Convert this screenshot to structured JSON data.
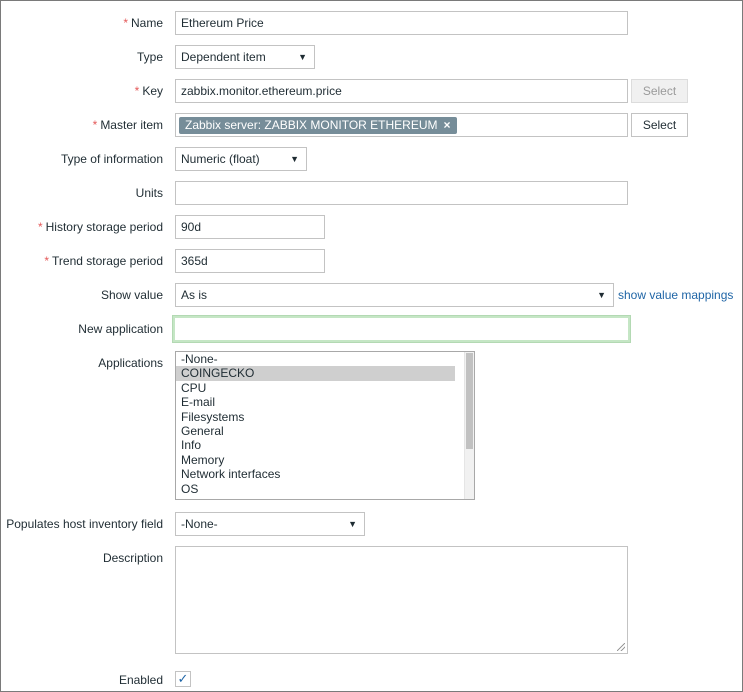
{
  "form": {
    "name": {
      "label": "Name",
      "required": "*",
      "value": "Ethereum Price"
    },
    "type": {
      "label": "Type",
      "value": "Dependent item"
    },
    "key": {
      "label": "Key",
      "required": "*",
      "value": "zabbix.monitor.ethereum.price",
      "button": "Select"
    },
    "master_item": {
      "label": "Master item",
      "required": "*",
      "tag": "Zabbix server: ZABBIX MONITOR ETHEREUM",
      "remove_icon": "×",
      "button": "Select"
    },
    "type_of_information": {
      "label": "Type of information",
      "value": "Numeric (float)"
    },
    "units": {
      "label": "Units",
      "value": ""
    },
    "history": {
      "label": "History storage period",
      "required": "*",
      "value": "90d"
    },
    "trend": {
      "label": "Trend storage period",
      "required": "*",
      "value": "365d"
    },
    "show_value": {
      "label": "Show value",
      "value": "As is",
      "link": "show value mappings"
    },
    "new_application": {
      "label": "New application",
      "value": ""
    },
    "applications": {
      "label": "Applications",
      "options": [
        "-None-",
        "COINGECKO",
        "CPU",
        "E-mail",
        "Filesystems",
        "General",
        "Info",
        "Memory",
        "Network interfaces",
        "OS"
      ],
      "selected": "COINGECKO"
    },
    "inventory": {
      "label": "Populates host inventory field",
      "value": "-None-"
    },
    "description": {
      "label": "Description",
      "value": ""
    },
    "enabled": {
      "label": "Enabled",
      "checked": true,
      "check_glyph": "✓"
    }
  },
  "icons": {
    "dropdown_caret": "▼"
  },
  "colors": {
    "required": "#e45959",
    "link": "#1f65a6",
    "tag_bg": "#768d99",
    "selected_option": "#cfcfcf",
    "focus_border": "#c5e6c5"
  }
}
